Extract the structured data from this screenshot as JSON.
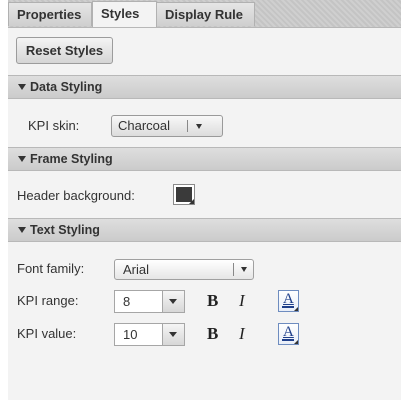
{
  "tabs": [
    {
      "label": "Properties",
      "active": false
    },
    {
      "label": "Styles",
      "active": true
    },
    {
      "label": "Display Rule",
      "active": false
    }
  ],
  "reset_button": {
    "label": "Reset Styles"
  },
  "sections": {
    "data_styling": {
      "title": "Data Styling",
      "kpi_skin": {
        "label": "KPI skin:",
        "value": "Charcoal"
      }
    },
    "frame_styling": {
      "title": "Frame Styling",
      "header_background": {
        "label": "Header background:",
        "color": "#3a3a3a"
      }
    },
    "text_styling": {
      "title": "Text Styling",
      "font_family": {
        "label": "Font family:",
        "value": "Arial"
      },
      "kpi_range": {
        "label": "KPI range:",
        "size": "8",
        "bold": "B",
        "italic": "I",
        "color_glyph": "A"
      },
      "kpi_value": {
        "label": "KPI value:",
        "size": "10",
        "bold": "B",
        "italic": "I",
        "color_glyph": "A"
      }
    }
  }
}
